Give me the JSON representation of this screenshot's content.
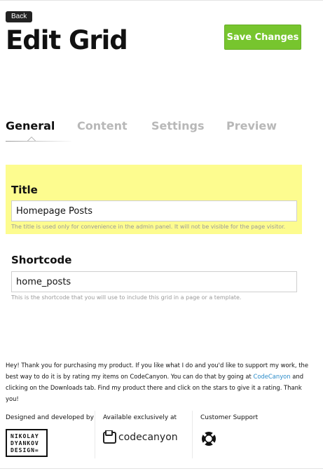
{
  "header": {
    "back_label": "Back",
    "title": "Edit Grid",
    "save_label": "Save Changes"
  },
  "tabs": [
    {
      "label": "General",
      "active": true
    },
    {
      "label": "Content",
      "active": false
    },
    {
      "label": "Settings",
      "active": false
    },
    {
      "label": "Preview",
      "active": false
    }
  ],
  "fields": {
    "title": {
      "label": "Title",
      "value": "Homepage Posts",
      "help": "The title is used only for convenience in the admin panel. It will not be visible for the page visitor."
    },
    "shortcode": {
      "label": "Shortcode",
      "value": "home_posts",
      "help": "This is the shortcode that you will use to include this grid in a page or a template."
    }
  },
  "thanks": {
    "text_before": "Hey! Thank you for purchasing my product. If you like what I do and you'd like to support my work, the best way to do it is by rating my items on CodeCanyon. You can do that by going at ",
    "link": "CodeCanyon",
    "text_after": " and clicking on the Downloads tab. Find my product there and click on the stars to give it a rating. Thank you!"
  },
  "credits": {
    "designed_label": "Designed and developed by",
    "designer_logo": "NIKOLAY DYANKOV DESIGN=",
    "available_label": "Available exclusively at",
    "market_logo": "codecanyon",
    "support_label": "Customer Support",
    "support_icon": "lifebuoy-icon"
  },
  "colors": {
    "save_button": "#77c52e",
    "highlight": "#fdfc8f",
    "link": "#2a8bc9",
    "inactive_tab": "#b8b8b8"
  }
}
